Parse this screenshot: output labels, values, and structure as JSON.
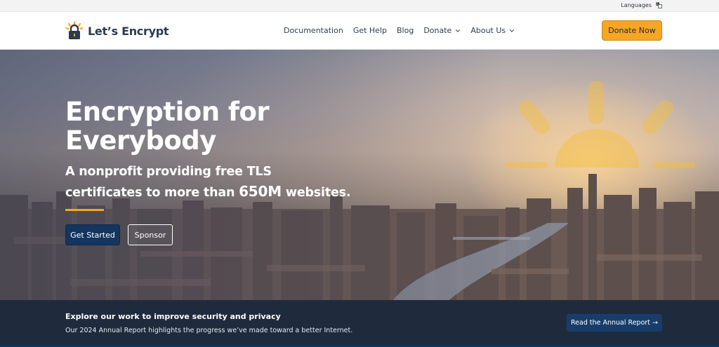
{
  "utility": {
    "languages_label": "Languages"
  },
  "brand": {
    "name": "Let’s Encrypt"
  },
  "nav": {
    "items": [
      {
        "label": "Documentation"
      },
      {
        "label": "Get Help"
      },
      {
        "label": "Blog"
      },
      {
        "label": "Donate"
      },
      {
        "label": "About Us"
      }
    ],
    "donate_now": "Donate Now"
  },
  "hero": {
    "title_line1": "Encryption for",
    "title_line2": "Everybody",
    "subtitle_line1": "A nonprofit providing free TLS",
    "subtitle_line2a": "certificates to more than ",
    "subtitle_line2b": "650M",
    "subtitle_line2c": " websites.",
    "get_started": "Get Started",
    "sponsor": "Sponsor"
  },
  "banner": {
    "title": "Explore our work to improve security and privacy",
    "text": "Our 2024 Annual Report highlights the progress we’ve made toward a better Internet.",
    "button": "Read the Annual Report →"
  },
  "colors": {
    "accent": "#f5a623",
    "navy": "#13355f",
    "banner_bg": "#1f2b3d"
  }
}
